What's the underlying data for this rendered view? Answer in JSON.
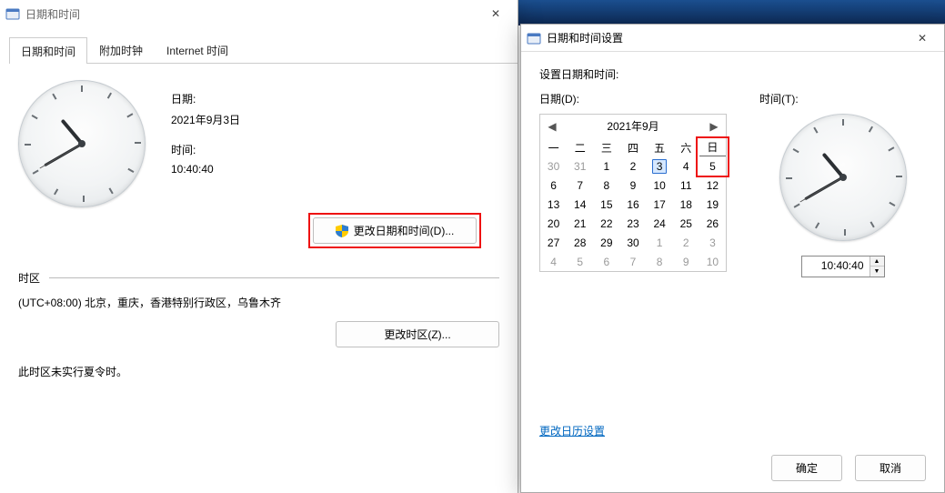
{
  "parentWindow": {
    "title": "日期和时间",
    "tabs": [
      "日期和时间",
      "附加时钟",
      "Internet 时间"
    ],
    "activeTab": 0,
    "date_label": "日期:",
    "date_value": "2021年9月3日",
    "time_label": "时间:",
    "time_value": "10:40:40",
    "change_dt_btn": "更改日期和时间(D)...",
    "tz_heading": "时区",
    "tz_value": "(UTC+08:00) 北京，重庆，香港特别行政区，乌鲁木齐",
    "change_tz_btn": "更改时区(Z)...",
    "dst_text": "此时区未实行夏令时。",
    "clock": {
      "hour": 10,
      "minute": 40,
      "second": 40
    }
  },
  "childWindow": {
    "title": "日期和时间设置",
    "heading": "设置日期和时间:",
    "date_label": "日期(D):",
    "time_label": "时间(T):",
    "calendar": {
      "month_label": "2021年9月",
      "weekday_headers": [
        "一",
        "二",
        "三",
        "四",
        "五",
        "六",
        "日"
      ],
      "cells": [
        {
          "n": 30,
          "out": true
        },
        {
          "n": 31,
          "out": true
        },
        {
          "n": 1
        },
        {
          "n": 2
        },
        {
          "n": 3,
          "today": true
        },
        {
          "n": 4
        },
        {
          "n": 5,
          "hi": true
        },
        {
          "n": 6
        },
        {
          "n": 7
        },
        {
          "n": 8
        },
        {
          "n": 9
        },
        {
          "n": 10
        },
        {
          "n": 11
        },
        {
          "n": 12
        },
        {
          "n": 13
        },
        {
          "n": 14
        },
        {
          "n": 15
        },
        {
          "n": 16
        },
        {
          "n": 17
        },
        {
          "n": 18
        },
        {
          "n": 19
        },
        {
          "n": 20
        },
        {
          "n": 21
        },
        {
          "n": 22
        },
        {
          "n": 23
        },
        {
          "n": 24
        },
        {
          "n": 25
        },
        {
          "n": 26
        },
        {
          "n": 27
        },
        {
          "n": 28
        },
        {
          "n": 29
        },
        {
          "n": 30
        },
        {
          "n": 1,
          "out": true
        },
        {
          "n": 2,
          "out": true
        },
        {
          "n": 3,
          "out": true
        },
        {
          "n": 4,
          "out": true
        },
        {
          "n": 5,
          "out": true
        },
        {
          "n": 6,
          "out": true
        },
        {
          "n": 7,
          "out": true
        },
        {
          "n": 8,
          "out": true
        },
        {
          "n": 9,
          "out": true
        },
        {
          "n": 10,
          "out": true
        }
      ]
    },
    "time_value": "10:40:40",
    "link": "更改日历设置",
    "ok_btn": "确定",
    "cancel_btn": "取消",
    "clock": {
      "hour": 10,
      "minute": 40,
      "second": 40
    }
  },
  "icons": {
    "close": "✕",
    "prev": "◀",
    "next": "▶",
    "up": "▲",
    "down": "▼"
  }
}
